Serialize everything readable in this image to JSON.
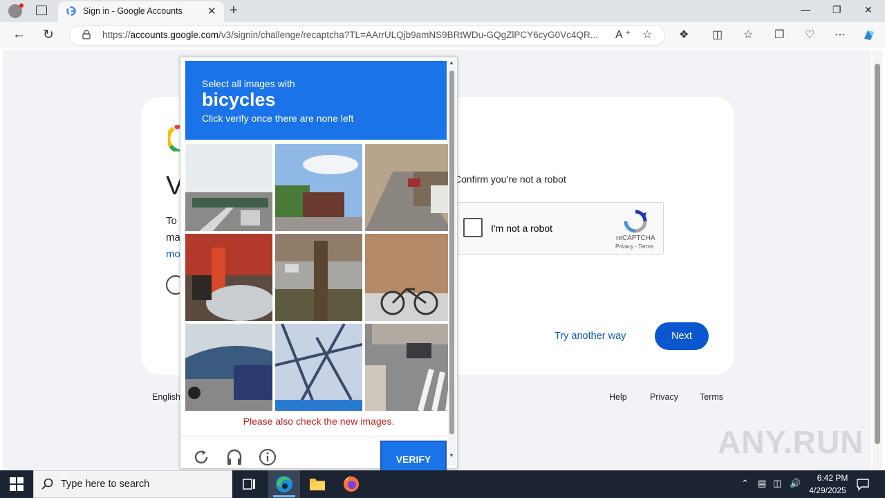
{
  "browser": {
    "tab_title": "Sign in - Google Accounts",
    "url_prefix": "https://",
    "url_domain": "accounts.google.com",
    "url_path": "/v3/signin/challenge/recaptcha?TL=AArrULQjb9amNS9BRtWDu-GQgZlPCY6cyG0Vc4QR...",
    "tab_close": "✕",
    "new_tab": "+",
    "minimize": "—",
    "restore": "❐",
    "close": "✕"
  },
  "page": {
    "partial_heading": "V",
    "partial_line1": "To",
    "partial_line2": "ma",
    "partial_link": "mo",
    "confirm_text": "Confirm you’re not a robot",
    "recaptcha": {
      "checkbox_label": "I'm not a robot",
      "brand": "reCAPTCHA",
      "links": "Privacy - Terms"
    },
    "try_another": "Try another way",
    "next": "Next",
    "footer": {
      "language": "English",
      "help": "Help",
      "privacy": "Privacy",
      "terms": "Terms"
    }
  },
  "challenge": {
    "line1": "Select all images with",
    "object": "bicycles",
    "line3": "Click verify once there are none left",
    "tiles": [
      "overpass-road",
      "roadside-shop",
      "parked-cars-street",
      "bus-stop-crowd",
      "tree-street",
      "bicycles-rack",
      "bus-terminal",
      "tree-shadow",
      "crosswalk-street"
    ],
    "warning": "Please also check the new images.",
    "verify": "VERIFY"
  },
  "watermark": "ANY.RUN",
  "taskbar": {
    "search_placeholder": "Type here to search",
    "time": "6:42 PM",
    "date": "4/29/2025"
  },
  "colors": {
    "challenge_header": "#1a73e8",
    "next_button": "#0b57d0",
    "warning": "#c5221f"
  }
}
